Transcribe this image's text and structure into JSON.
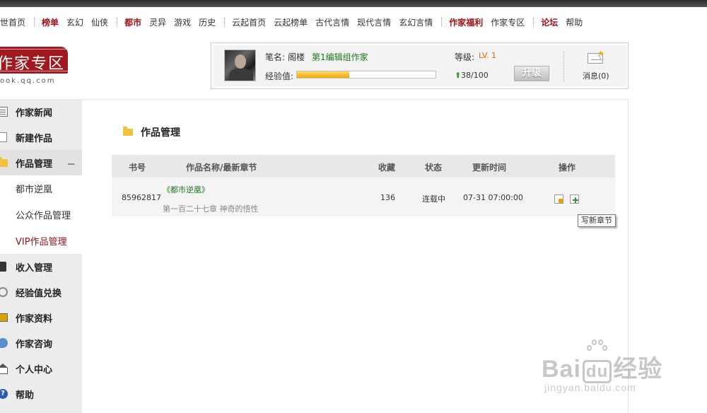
{
  "topnav": {
    "groups": [
      [
        {
          "label": "世首页",
          "hl": false
        }
      ],
      [
        {
          "label": "榜单",
          "hl": true
        },
        {
          "label": "玄幻",
          "hl": false
        },
        {
          "label": "仙侠",
          "hl": false
        }
      ],
      [
        {
          "label": "都市",
          "hl": true
        },
        {
          "label": "灵异",
          "hl": false
        },
        {
          "label": "游戏",
          "hl": false
        },
        {
          "label": "历史",
          "hl": false
        }
      ],
      [
        {
          "label": "云起首页",
          "hl": false
        },
        {
          "label": "云起榜单",
          "hl": false
        },
        {
          "label": "古代言情",
          "hl": false
        },
        {
          "label": "现代言情",
          "hl": false
        },
        {
          "label": "玄幻言情",
          "hl": false
        }
      ],
      [
        {
          "label": "作家福利",
          "hl": true
        },
        {
          "label": "作家专区",
          "hl": false
        }
      ],
      [
        {
          "label": "论坛",
          "hl": true
        },
        {
          "label": "帮助",
          "hl": false
        }
      ]
    ]
  },
  "logo": {
    "title": "作家专区",
    "subtitle": "ook.qq.com"
  },
  "user": {
    "pen_label": "笔名:",
    "pen_name": "阁楼",
    "editor_group": "第1编辑组作家",
    "exp_label": "经验值:",
    "exp_progress": 0.38,
    "level_label": "等级:",
    "level_value": "LV. 1",
    "exp_count": "38/100",
    "upgrade_label": "升级",
    "message_label": "消息(0)"
  },
  "sidebar": {
    "items": [
      {
        "label": "作家新闻",
        "icon": "news-icon"
      },
      {
        "label": "新建作品",
        "icon": "new-doc-icon"
      },
      {
        "label": "作品管理",
        "icon": "folder-icon",
        "toggle": "－"
      },
      {
        "label": "收入管理",
        "icon": "income-icon"
      },
      {
        "label": "经验值兑换",
        "icon": "exchange-icon"
      },
      {
        "label": "作家资料",
        "icon": "profile-icon"
      },
      {
        "label": "作家咨询",
        "icon": "consult-icon"
      },
      {
        "label": "个人中心",
        "icon": "home-icon"
      },
      {
        "label": "帮助",
        "icon": "help-icon"
      }
    ],
    "subitems": [
      "都市逆凰",
      "公众作品管理",
      "VIP作品管理"
    ]
  },
  "main": {
    "section_title": "作品管理",
    "columns": [
      "书号",
      "作品名称/最新章节",
      "收藏",
      "状态",
      "更新时间",
      "操作"
    ],
    "rows": [
      {
        "id": "85962817",
        "title": "《都市逆凰》",
        "chapter": "第一百二十七章 神奇的悟性",
        "favorites": "136",
        "status": "连载中",
        "updated": "07-31 07:00:00"
      }
    ],
    "tooltip": "写新章节"
  },
  "watermark": {
    "brand_a": "Bai",
    "brand_b": "du",
    "brand_c": "经验",
    "url": "jingyan.baidu.com"
  },
  "colors": {
    "accent_red": "#a0121b",
    "link_green": "#1b7a1b",
    "exp_orange": "#f0a800"
  }
}
